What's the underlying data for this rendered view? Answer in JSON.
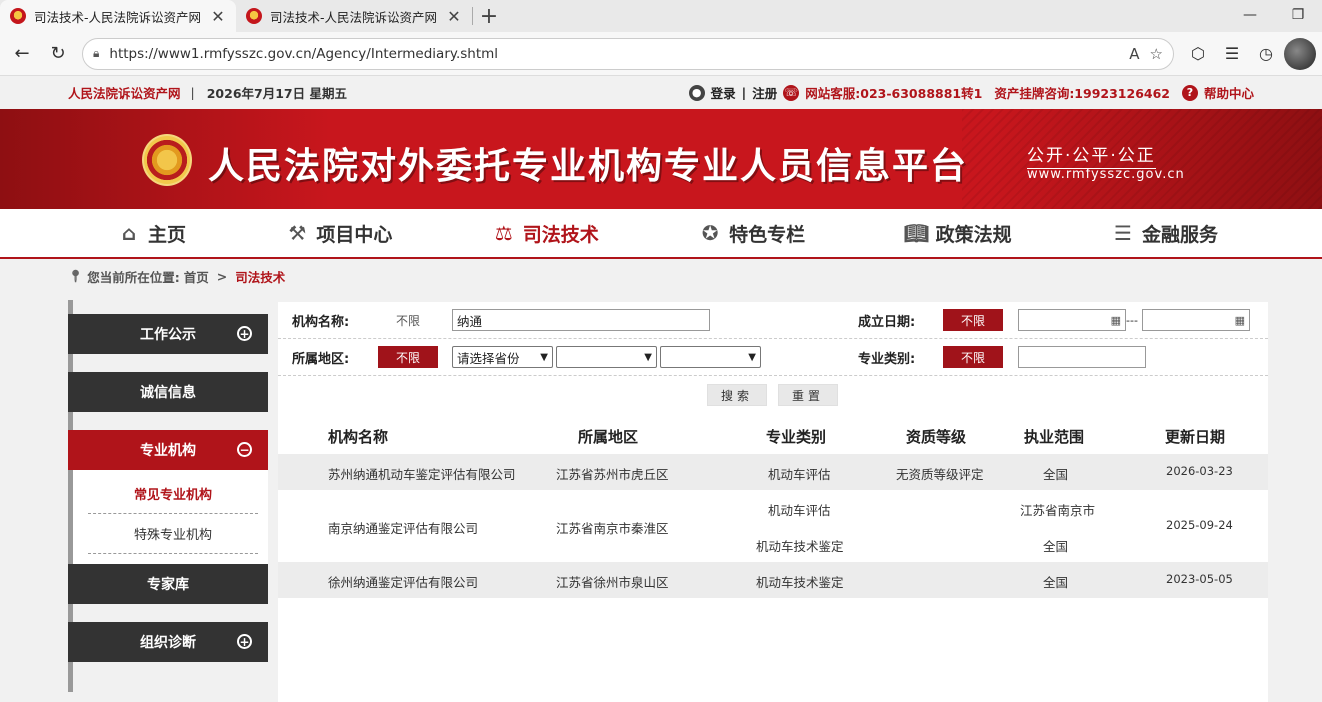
{
  "browser": {
    "tabs": [
      {
        "title": "司法技术-人民法院诉讼资产网",
        "close": "✕"
      },
      {
        "title": "司法技术-人民法院诉讼资产网",
        "close": "✕"
      }
    ],
    "new_tab": "+",
    "url": "https://www1.rmfysszc.gov.cn/Agency/Intermediary.shtml"
  },
  "topbar": {
    "site_name": "人民法院诉讼资产网",
    "separator": "|",
    "date": "2026年7月17日  星期五",
    "login": "登录",
    "register": "注册",
    "divider": "|",
    "service": "网站客服:023-63088881转1",
    "listing": "资产挂牌咨询:19923126462",
    "help": "帮助中心"
  },
  "banner": {
    "title": "人民法院对外委托专业机构专业人员信息平台",
    "slogan": "公开·公平·公正",
    "domain": "www.rmfysszc.gov.cn"
  },
  "nav": {
    "items": [
      {
        "label": "主页",
        "icon": "home-icon"
      },
      {
        "label": "项目中心",
        "icon": "hammer-icon"
      },
      {
        "label": "司法技术",
        "icon": "scales-icon"
      },
      {
        "label": "特色专栏",
        "icon": "star-badge-icon"
      },
      {
        "label": "政策法规",
        "icon": "book-icon"
      },
      {
        "label": "金融服务",
        "icon": "coins-icon"
      }
    ],
    "active_index": 2
  },
  "breadcrumb": {
    "prefix": "您当前所在位置:",
    "home": "首页",
    "sep": ">",
    "current": "司法技术"
  },
  "sidebar": {
    "sections": [
      {
        "label": "工作公示",
        "toggle": "+"
      },
      {
        "label": "诚信信息"
      },
      {
        "label": "专业机构",
        "toggle": "−",
        "items": [
          "常见专业机构",
          "特殊专业机构"
        ]
      },
      {
        "label": "专家库"
      },
      {
        "label": "组织诊断",
        "toggle": "+"
      }
    ]
  },
  "filters": {
    "name_label": "机构名称:",
    "name_unlimited": "不限",
    "name_value": "纳通",
    "date_label": "成立日期:",
    "date_unlimited": "不限",
    "date_from": "",
    "date_to": "",
    "date_sep": "---",
    "region_label": "所属地区:",
    "region_unlimited": "不限",
    "province_placeholder": "请选择省份",
    "city": "",
    "district": "",
    "type_label": "专业类别:",
    "type_unlimited": "不限",
    "type_value": "",
    "search_button": "搜索",
    "reset_button": "重置"
  },
  "table": {
    "headers": [
      "机构名称",
      "所属地区",
      "专业类别",
      "资质等级",
      "执业范围",
      "更新日期"
    ],
    "rows": [
      {
        "name": "苏州纳通机动车鉴定评估有限公司",
        "region": "江苏省苏州市虎丘区",
        "types": [
          "机动车评估"
        ],
        "level": "无资质等级评定",
        "scopes": [
          "全国"
        ],
        "date": "2026-03-23"
      },
      {
        "name": "南京纳通鉴定评估有限公司",
        "region": "江苏省南京市秦淮区",
        "types": [
          "机动车评估",
          "机动车技术鉴定"
        ],
        "level": "",
        "scopes": [
          "江苏省南京市",
          "全国"
        ],
        "date": "2025-09-24"
      },
      {
        "name": "徐州纳通鉴定评估有限公司",
        "region": "江苏省徐州市泉山区",
        "types": [
          "机动车技术鉴定"
        ],
        "level": "",
        "scopes": [
          "全国"
        ],
        "date": "2023-05-05"
      }
    ]
  },
  "colors": {
    "brand_red": "#b0141a",
    "dark": "#333333"
  }
}
